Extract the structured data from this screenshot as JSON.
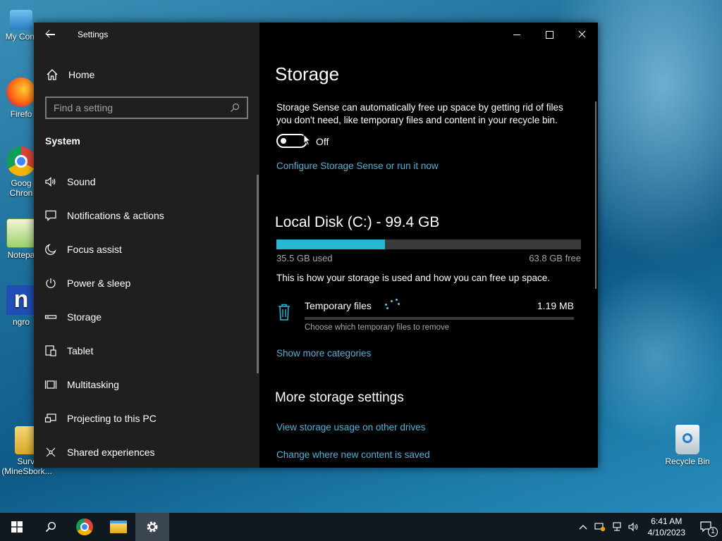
{
  "desktop": {
    "icons": [
      {
        "label": "My Com"
      },
      {
        "label": "Firefo"
      },
      {
        "label": "Goog"
      },
      {
        "label": "Chron"
      },
      {
        "label": "Notepa"
      },
      {
        "label": "ngro"
      },
      {
        "label": "Survi"
      },
      {
        "label": "(MineSbork..."
      },
      {
        "label": "Recycle Bin"
      }
    ]
  },
  "window": {
    "title": "Settings",
    "sidebar": {
      "home_label": "Home",
      "search_placeholder": "Find a setting",
      "section": "System",
      "items": [
        {
          "label": "Sound",
          "icon": "speaker-icon"
        },
        {
          "label": "Notifications & actions",
          "icon": "notification-icon"
        },
        {
          "label": "Focus assist",
          "icon": "moon-icon"
        },
        {
          "label": "Power & sleep",
          "icon": "power-icon"
        },
        {
          "label": "Storage",
          "icon": "storage-icon"
        },
        {
          "label": "Tablet",
          "icon": "tablet-icon"
        },
        {
          "label": "Multitasking",
          "icon": "multitasking-icon"
        },
        {
          "label": "Projecting to this PC",
          "icon": "projecting-icon"
        },
        {
          "label": "Shared experiences",
          "icon": "shared-icon"
        }
      ]
    },
    "main": {
      "title": "Storage",
      "description": "Storage Sense can automatically free up space by getting rid of files you don't need, like temporary files and content in your recycle bin.",
      "toggle_state": "Off",
      "configure_link": "Configure Storage Sense or run it now",
      "disk_title": "Local Disk (C:) - 99.4 GB",
      "used_label": "35.5 GB used",
      "free_label": "63.8 GB free",
      "used_fraction": 0.357,
      "usage_note": "This is how your storage is used and how you can free up space.",
      "category": {
        "name": "Temporary files",
        "size": "1.19 MB",
        "sub": "Choose which temporary files to remove"
      },
      "show_more_link": "Show more categories",
      "more_title": "More storage settings",
      "link_other_drives": "View storage usage on other drives",
      "link_new_content": "Change where new content is saved"
    }
  },
  "taskbar": {
    "time": "6:41 AM",
    "date": "4/10/2023",
    "notification_count": "1",
    "accent": "#29b6d1"
  }
}
